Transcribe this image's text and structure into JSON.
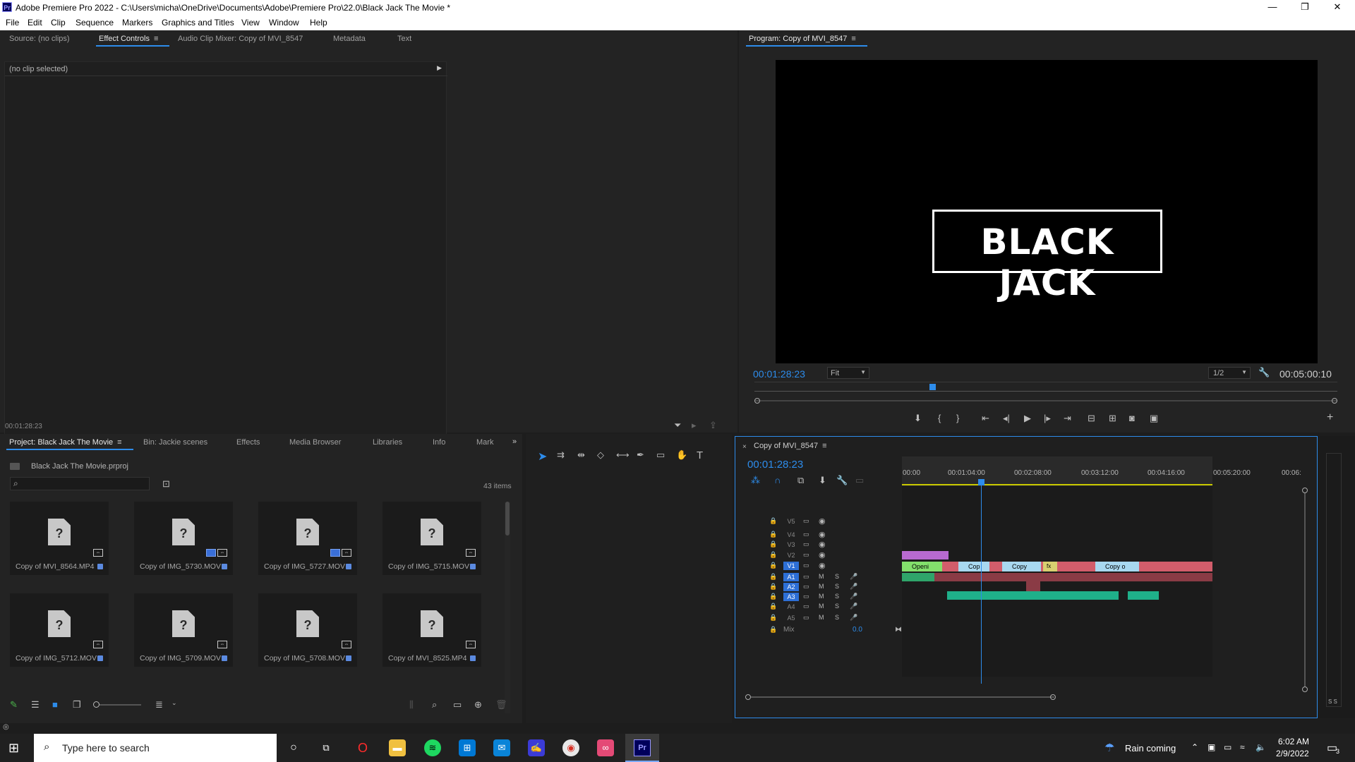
{
  "window": {
    "title": "Adobe Premiere Pro 2022 - C:\\Users\\micha\\OneDrive\\Documents\\Adobe\\Premiere Pro\\22.0\\Black Jack The Movie *",
    "app_icon": "Pr",
    "minimize": "—",
    "maximize": "❐",
    "close": "✕"
  },
  "menu": [
    "File",
    "Edit",
    "Clip",
    "Sequence",
    "Markers",
    "Graphics and Titles",
    "View",
    "Window",
    "Help"
  ],
  "source_panel": {
    "tabs": [
      "Source: (no clips)",
      "Effect Controls",
      "Audio Clip Mixer: Copy of MVI_8547",
      "Metadata",
      "Text"
    ],
    "active_tab": "Effect Controls",
    "no_clip_text": "(no clip selected)",
    "timecode": "00:01:28:23"
  },
  "program_monitor": {
    "title": "Program: Copy of MVI_8547",
    "title_card_text": "BLACK JACK",
    "timecode": "00:01:28:23",
    "zoom": "Fit",
    "resolution": "1/2",
    "duration": "00:05:00:10",
    "playhead_fraction": 0.3
  },
  "project_panel": {
    "tabs": [
      "Project: Black Jack The Movie",
      "Bin: Jackie scenes",
      "Effects",
      "Media Browser",
      "Libraries",
      "Info",
      "Mark"
    ],
    "active_tab": "Project: Black Jack The Movie",
    "project_file": "Black Jack The Movie.prproj",
    "item_count": "43 items",
    "items": [
      {
        "name": "Copy of MVI_8564.MP4",
        "multi": false
      },
      {
        "name": "Copy of IMG_5730.MOV",
        "multi": true
      },
      {
        "name": "Copy of IMG_5727.MOV",
        "multi": true
      },
      {
        "name": "Copy of IMG_5715.MOV",
        "multi": false
      },
      {
        "name": "Copy of IMG_5712.MOV",
        "multi": false
      },
      {
        "name": "Copy of IMG_5709.MOV",
        "multi": false
      },
      {
        "name": "Copy of IMG_5708.MOV",
        "multi": false
      },
      {
        "name": "Copy of MVI_8525.MP4",
        "multi": false
      }
    ]
  },
  "timeline": {
    "sequence_name": "Copy of MVI_8547",
    "timecode": "00:01:28:23",
    "ruler": [
      "00:00",
      "00:01:04:00",
      "00:02:08:00",
      "00:03:12:00",
      "00:04:16:00",
      "00:05:20:00",
      "00:06:"
    ],
    "video_tracks": [
      "V5",
      "V4",
      "V3",
      "V2",
      "V1"
    ],
    "audio_tracks": [
      "A1",
      "A2",
      "A3",
      "A4",
      "A5"
    ],
    "mix_label": "Mix",
    "mix_value": "0.0",
    "clip_labels": [
      "Openi",
      "Cop",
      "Copy",
      "fx",
      "Copy o"
    ],
    "m_label": "M",
    "s_label": "S"
  },
  "meters": {
    "labels": "S S"
  },
  "taskbar": {
    "search_placeholder": "Type here to search",
    "weather": "Rain coming",
    "time": "6:02 AM",
    "date": "2/9/2022",
    "notifications": "3"
  }
}
